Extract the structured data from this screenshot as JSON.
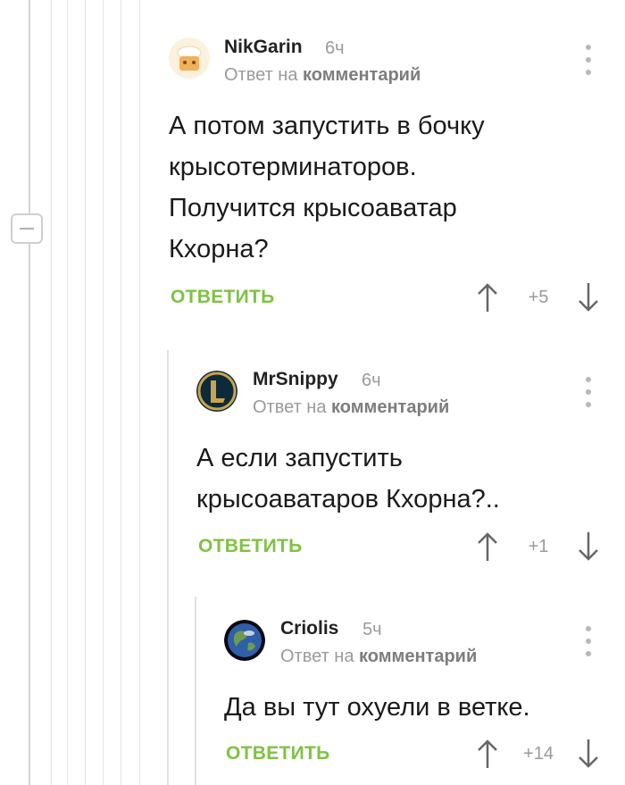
{
  "comments": [
    {
      "author": "NikGarin",
      "time": "6ч",
      "reply_prefix": "Ответ на",
      "reply_link": "комментарий",
      "body_lines": [
        "А потом запустить в бочку",
        "крысотерминаторов.",
        "Получится крысоаватар",
        "Кхорна?"
      ],
      "reply_label": "ОТВЕТИТЬ",
      "score": "+5",
      "avatar_icon": "chef-avatar-icon"
    },
    {
      "author": "MrSnippy",
      "time": "6ч",
      "reply_prefix": "Ответ на",
      "reply_link": "комментарий",
      "body_lines": [
        "А если запустить",
        "крысоаватаров Кхорна?.."
      ],
      "reply_label": "ОТВЕТИТЬ",
      "score": "+1",
      "avatar_icon": "league-logo-avatar-icon"
    },
    {
      "author": "Criolis",
      "time": "5ч",
      "reply_prefix": "Ответ на",
      "reply_link": "комментарий",
      "body_lines": [
        "Да вы тут охуели в ветке."
      ],
      "reply_label": "ОТВЕТИТЬ",
      "score": "+14",
      "avatar_icon": "earth-avatar-icon"
    }
  ],
  "colors": {
    "accent": "#7fc243",
    "muted": "#9a9a9a",
    "line": "#e3e3e3"
  }
}
